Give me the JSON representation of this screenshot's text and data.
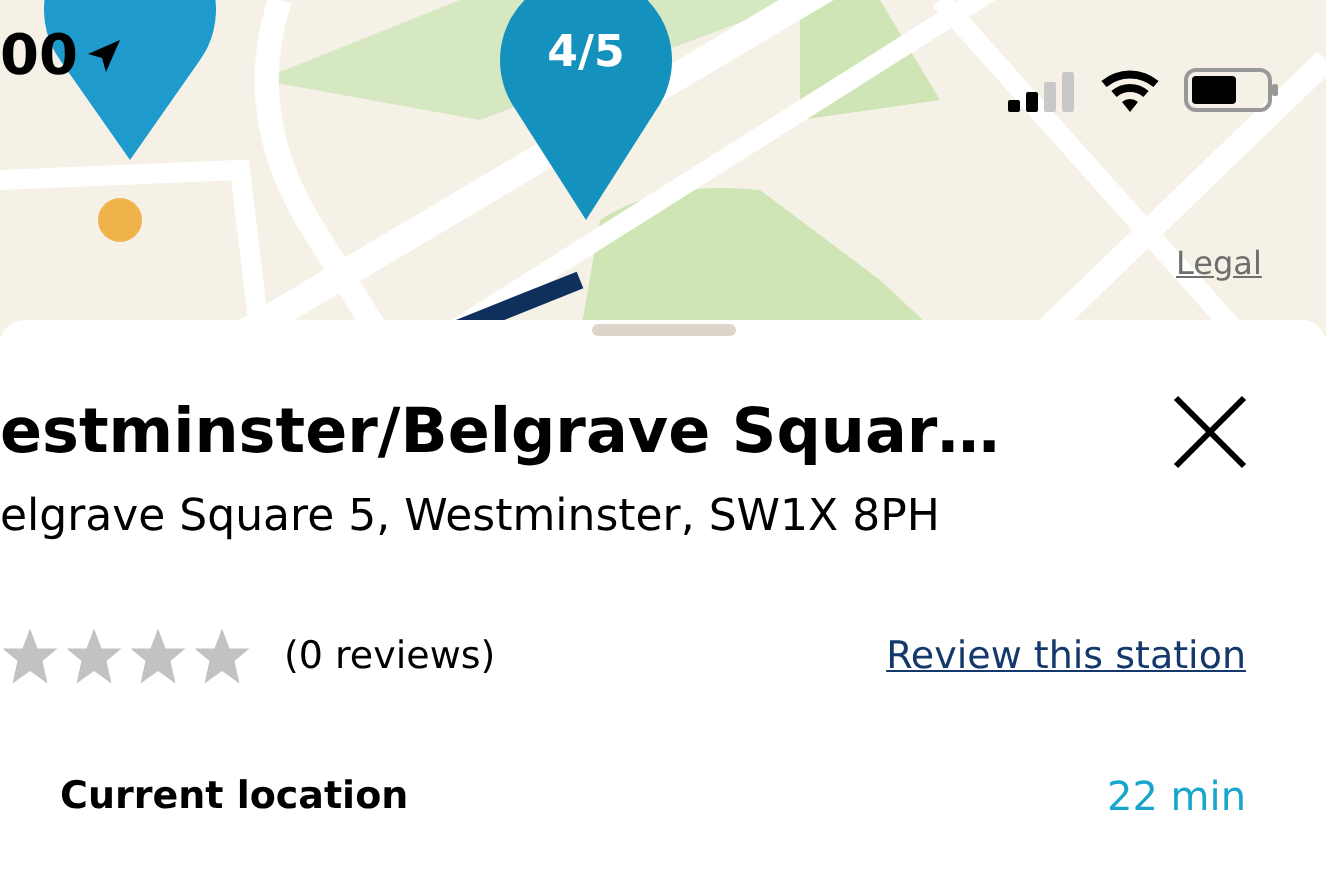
{
  "status_bar": {
    "time": "00"
  },
  "map": {
    "pins": [
      {
        "label": "4/5"
      }
    ],
    "legal_link": "Legal"
  },
  "station": {
    "title": "estminster/Belgrave Squar…",
    "address": "elgrave Square 5, Westminster, SW1X 8PH",
    "stars": 0,
    "reviews": "(0 reviews)",
    "review_link": "Review this station"
  },
  "route": {
    "origin": "Current location",
    "duration": "22 min"
  }
}
